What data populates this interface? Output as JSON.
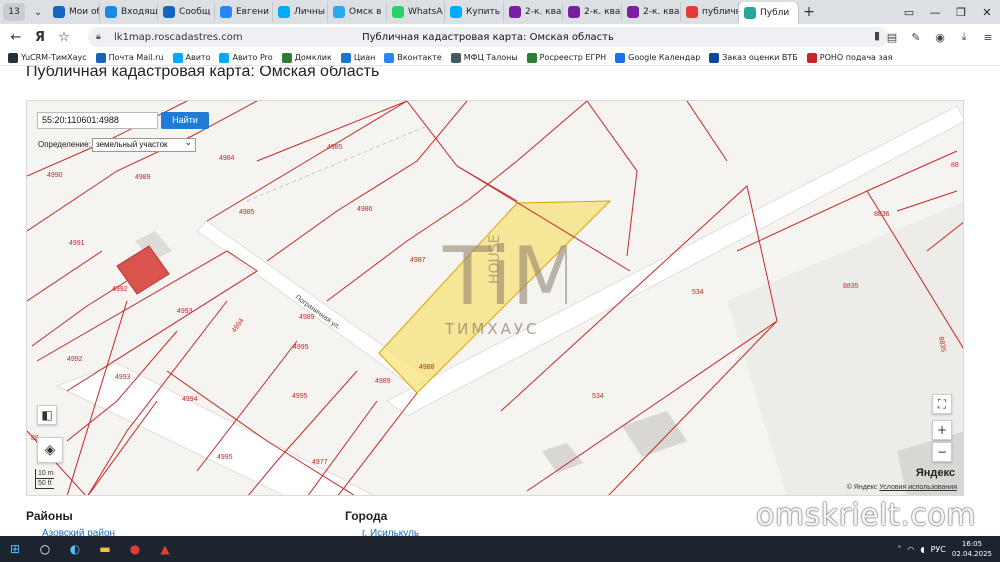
{
  "browser": {
    "tab_count": "13",
    "tabs": [
      {
        "label": "Мои об",
        "icon": "mail-icon",
        "color": "#1565c0"
      },
      {
        "label": "Входящ",
        "icon": "mail-icon",
        "color": "#1e88e5"
      },
      {
        "label": "Сообщ",
        "icon": "avito-icon",
        "color": "#1565c0"
      },
      {
        "label": "Евгени",
        "icon": "vk-icon",
        "color": "#2787f5"
      },
      {
        "label": "Личны",
        "icon": "avito-icon",
        "color": "#00aaff"
      },
      {
        "label": "Омск в",
        "icon": "telegram-icon",
        "color": "#29a9eb"
      },
      {
        "label": "WhatsA",
        "icon": "whatsapp-icon",
        "color": "#25d366"
      },
      {
        "label": "Купить",
        "icon": "avito-icon",
        "color": "#00aaff"
      },
      {
        "label": "2-к. ква",
        "icon": "avito-icon",
        "color": "#7b1fa2"
      },
      {
        "label": "2-к. ква",
        "icon": "avito-icon",
        "color": "#7b1fa2"
      },
      {
        "label": "2-к. ква",
        "icon": "avito-icon",
        "color": "#7b1fa2"
      },
      {
        "label": "публичн",
        "icon": "yandex-icon",
        "color": "#e53935"
      },
      {
        "label": "Публи",
        "icon": "map-icon",
        "color": "#26a69a",
        "active": true
      }
    ],
    "url": "lk1map.roscadastres.com",
    "page_title": "Публичная кадастровая карта: Омская область",
    "bookmarks": [
      {
        "label": "YuCRM-ТимХаус",
        "color": "#263238"
      },
      {
        "label": "Почта Mail.ru",
        "color": "#1565c0"
      },
      {
        "label": "Авито",
        "color": "#00aaff"
      },
      {
        "label": "Авито Pro",
        "color": "#00aaff"
      },
      {
        "label": "Домклик",
        "color": "#2e7d32"
      },
      {
        "label": "Циан",
        "color": "#1976d2"
      },
      {
        "label": "Вконтакте",
        "color": "#2787f5"
      },
      {
        "label": "МФЦ Талоны",
        "color": "#455a64"
      },
      {
        "label": "Росреестр ЕГРН",
        "color": "#2e7d32"
      },
      {
        "label": "Google Календар",
        "color": "#1a73e8"
      },
      {
        "label": "Заказ оценки ВТБ",
        "color": "#0d47a1"
      },
      {
        "label": "РОНО подача зая",
        "color": "#c62828"
      }
    ]
  },
  "page": {
    "heading": "Публичная кадастровая карта: Омская область",
    "search_value": "55:20:110601:4988",
    "find_button": "Найти",
    "definition_label": "Определение:",
    "definition_value": "земельный участок",
    "scale_m": "10 m",
    "scale_ft": "50 ft",
    "copyright": "© Яндекс",
    "terms": "Условия использования",
    "yandex_logo": "Яндекс",
    "section_districts": "Районы",
    "section_cities": "Города",
    "district_link": "Азовский район",
    "city_link": "г. Исилькуль",
    "street_label": "Пограничная ул."
  },
  "map_labels": [
    {
      "id": "l4985a",
      "text": "4985"
    },
    {
      "id": "l4984",
      "text": "4984"
    },
    {
      "id": "l4990",
      "text": "4990"
    },
    {
      "id": "l4989a",
      "text": "4989"
    },
    {
      "id": "l4985b",
      "text": "4985"
    },
    {
      "id": "l4986",
      "text": "4986"
    },
    {
      "id": "l4991",
      "text": "4991"
    },
    {
      "id": "l4987",
      "text": "4987"
    },
    {
      "id": "l4992a",
      "text": "4992"
    },
    {
      "id": "l4993a",
      "text": "4993"
    },
    {
      "id": "l4994a",
      "text": "4994"
    },
    {
      "id": "l4989b",
      "text": "4989"
    },
    {
      "id": "l4995a",
      "text": "4995"
    },
    {
      "id": "l4992b",
      "text": "4992"
    },
    {
      "id": "l4993b",
      "text": "4993"
    },
    {
      "id": "l4989c",
      "text": "4989"
    },
    {
      "id": "l4988",
      "text": "4988"
    },
    {
      "id": "l4994b",
      "text": "4994"
    },
    {
      "id": "l4995b",
      "text": "4995"
    },
    {
      "id": "l4995c",
      "text": "4995"
    },
    {
      "id": "l4977",
      "text": "4977"
    },
    {
      "id": "l534a",
      "text": "534"
    },
    {
      "id": "l534b",
      "text": "534"
    },
    {
      "id": "l8836",
      "text": "8836"
    },
    {
      "id": "l8835a",
      "text": "8835"
    },
    {
      "id": "l8835b",
      "text": "8835"
    },
    {
      "id": "l88a",
      "text": "88"
    },
    {
      "id": "l88b",
      "text": "88"
    }
  ],
  "watermark": {
    "logo_letters": "TiM",
    "logo_house": "HOUSE",
    "logo_sub": "ТИМХАУС",
    "site": "omskrielt.com"
  },
  "taskbar": {
    "lang": "РУС",
    "time": "16:05",
    "date": "02.04.2025"
  },
  "colors": {
    "parcel_line": "#c62828",
    "selected_fill": "#f6e27a",
    "building_fill": "#d9534f",
    "accent": "#1f7bd6"
  }
}
